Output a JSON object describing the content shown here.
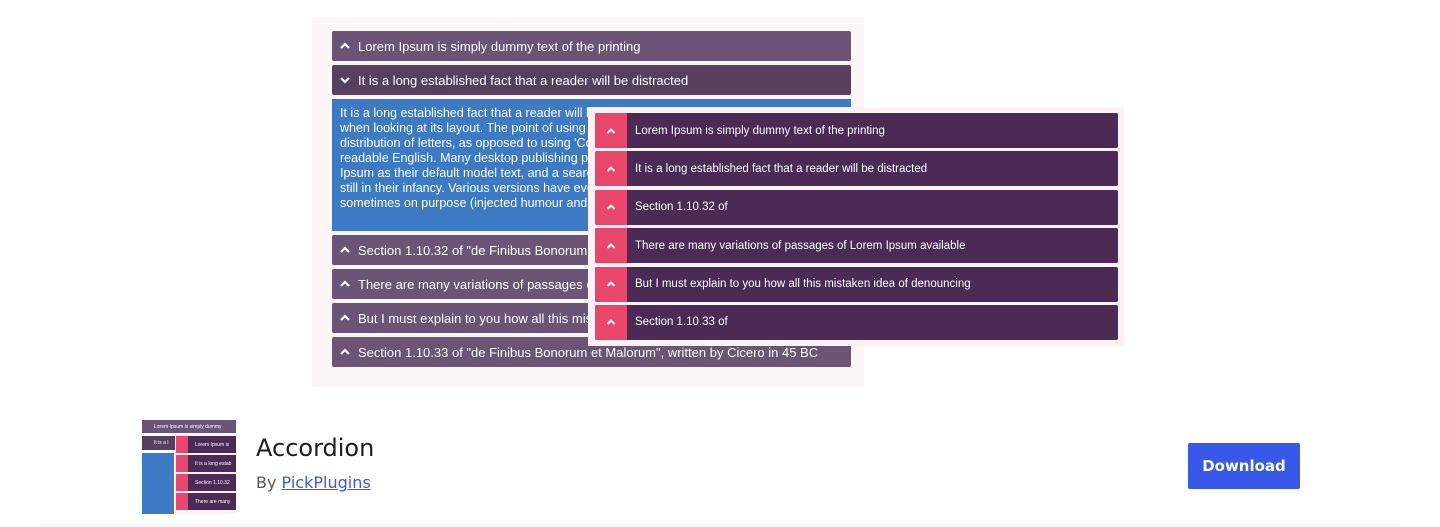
{
  "banner": {
    "left_accordion": {
      "items": [
        {
          "label": "Lorem Ipsum is simply dummy text of the printing",
          "state": "collapsed"
        },
        {
          "label": "It is a long established fact that a reader will be distracted",
          "state": "expanded"
        },
        {
          "label": "Section 1.10.32 of \"de Finibus Bonorum et Malorum\", written by Cicero in 45 BC",
          "state": "collapsed"
        },
        {
          "label": "There are many variations of passages of Lorem Ipsum available",
          "state": "collapsed"
        },
        {
          "label": "But I must explain to you how all this mistaken idea of denouncing",
          "state": "collapsed"
        },
        {
          "label": "Section 1.10.33 of \"de Finibus Bonorum et Malorum\", written by Cicero in 45 BC",
          "state": "collapsed"
        }
      ],
      "content_lines": [
        "It is a long established fact that a reader will be",
        "when looking at its layout. The point of using L",
        "distribution of letters, as opposed to using 'Con",
        "readable English. Many desktop publishing pac",
        "Ipsum as their default model text, and a search",
        "still in their infancy. Various versions have evol",
        "sometimes on purpose (injected humour and th"
      ]
    },
    "right_accordion": {
      "items": [
        {
          "label": "Lorem Ipsum is simply dummy text of the printing"
        },
        {
          "label": "It is a long established fact that a reader will be distracted"
        },
        {
          "label": "Section 1.10.32 of"
        },
        {
          "label": "There are many variations of passages of Lorem Ipsum available"
        },
        {
          "label": "But I must explain to you how all this mistaken idea of denouncing"
        },
        {
          "label": "Section 1.10.33 of"
        }
      ]
    }
  },
  "plugin": {
    "name": "Accordion",
    "by_prefix": "By",
    "author": "PickPlugins",
    "download_label": "Download",
    "thumbnail": {
      "header_1": "Lorem Ipsum is simply dummy",
      "header_2": "It is a l",
      "rows": [
        "Lorem Ipsum is",
        "It is a long estab",
        "Section 1.10.32",
        "There are many"
      ]
    }
  },
  "colors": {
    "accent": "#3858e9",
    "accordion_header": "#6b5475",
    "accordion_open": "#57405e",
    "accordion_content": "#3d7ac6",
    "overlay_row": "#4b2a55",
    "overlay_icon": "#e8466a"
  }
}
